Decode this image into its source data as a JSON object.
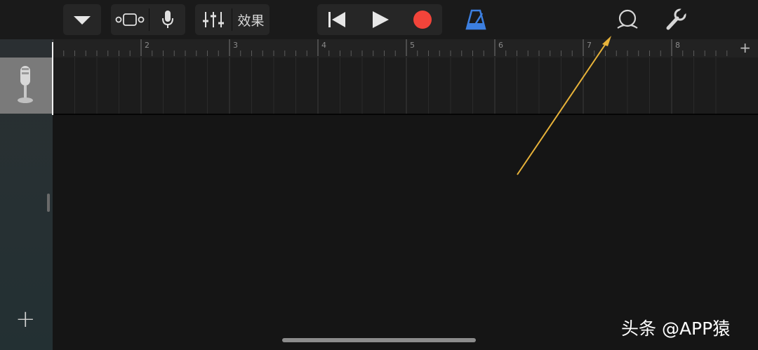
{
  "toolbar": {
    "effects_label": "效果",
    "icons": [
      "dropdown-triangle-icon",
      "tracks-view-icon",
      "microphone-icon",
      "mixer-icon",
      "rewind-icon",
      "play-icon",
      "record-icon",
      "metronome-icon",
      "loop-browser-icon",
      "settings-wrench-icon"
    ]
  },
  "ruler": {
    "bars": [
      "2",
      "3",
      "4",
      "5",
      "6",
      "7",
      "8"
    ],
    "add_label": "+"
  },
  "sidebar": {
    "add_track_label": "+",
    "track_instrument_icon": "microphone-icon"
  },
  "colors": {
    "record": "#f2443a",
    "metronome": "#3c7fe0",
    "annotation_arrow": "#e8b33a"
  },
  "watermark": "头条 @APP猿"
}
